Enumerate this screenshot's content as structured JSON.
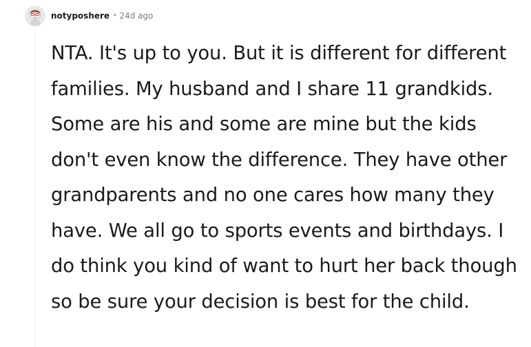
{
  "comment": {
    "username": "notyposhere",
    "separator": "•",
    "timestamp": "24d ago",
    "avatar_icon": "snoo-avatar-icon",
    "body": "NTA. It's up to you. But it is different for different families. My husband and I share 11 grandkids. Some are his and some are mine but the kids don't even know the difference. They have other grandparents and no one cares how many they have. We all go to sports events and birthdays. I do think you kind of want to hurt her back though so be sure your decision is best for the child."
  }
}
